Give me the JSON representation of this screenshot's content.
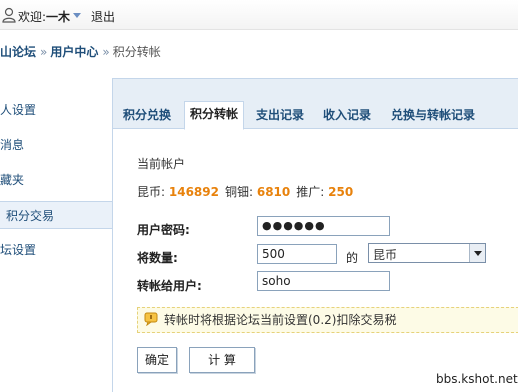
{
  "topbar": {
    "greeting": "欢迎:",
    "username": "一木",
    "logout": "退出"
  },
  "breadcrumb": {
    "forum": "山论坛",
    "user_center": "用户中心",
    "current": "积分转帐",
    "separator": "»"
  },
  "sidebar": {
    "items": [
      {
        "label": "人设置"
      },
      {
        "label": "消息"
      },
      {
        "label": "藏夹"
      },
      {
        "label": "积分交易",
        "active": true
      },
      {
        "label": "坛设置"
      }
    ]
  },
  "tabs": [
    {
      "label": "积分兑换"
    },
    {
      "label": "积分转帐",
      "active": true
    },
    {
      "label": "支出记录"
    },
    {
      "label": "收入记录"
    },
    {
      "label": "兑换与转帐记录"
    }
  ],
  "account": {
    "label": "当前帐户",
    "items": [
      {
        "name": "昆币:",
        "value": "146892"
      },
      {
        "name": "铜钿:",
        "value": "6810"
      },
      {
        "name": "推广:",
        "value": "250"
      }
    ]
  },
  "form": {
    "password_label": "用户密码:",
    "password_value": "●●●●●●",
    "amount_label": "将数量:",
    "amount_value": "500",
    "of_label": "的",
    "currency_selected": "昆币",
    "recipient_label": "转帐给用户:",
    "recipient_value": "soho"
  },
  "notice": {
    "text": "转帐时将根据论坛当前设置(0.2)扣除交易税"
  },
  "buttons": {
    "confirm": "确定",
    "calculate": "计 算"
  },
  "watermark": "bbs.kshot.net",
  "colors": {
    "accent_link": "#1f4e79",
    "number_orange": "#e8820c",
    "tab_bg": "#e6eef6",
    "notice_bg": "#fdfbe6"
  }
}
